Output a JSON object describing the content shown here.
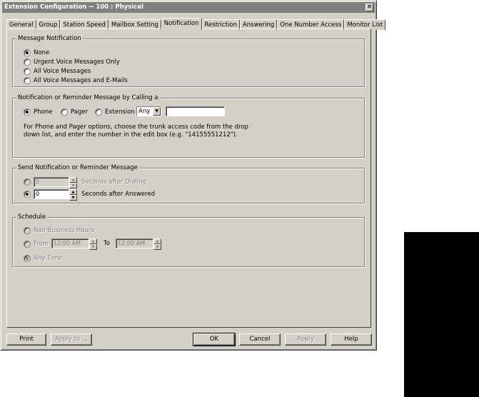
{
  "window": {
    "title": "Extension Configuration -- 100 : Physical",
    "close_glyph": "✕"
  },
  "tabs": [
    {
      "label": "General"
    },
    {
      "label": "Group"
    },
    {
      "label": "Station Speed"
    },
    {
      "label": "Mailbox Setting"
    },
    {
      "label": "Notification",
      "active": true
    },
    {
      "label": "Restriction"
    },
    {
      "label": "Answering"
    },
    {
      "label": "One Number Access"
    },
    {
      "label": "Monitor List"
    }
  ],
  "message_notification": {
    "title": "Message Notification",
    "options": [
      "None",
      "Urgent Voice Messages Only",
      "All Voice Messages",
      "All Voice Messages and E-Mails"
    ],
    "selected": "None"
  },
  "calling": {
    "title": "Notification or Reminder Message by Calling a",
    "options": [
      "Phone",
      "Pager",
      "Extension"
    ],
    "selected": "Phone",
    "access_code": "Any",
    "number_value": "",
    "help_line1": "For Phone and Pager options, choose the trunk access code from the drop",
    "help_line2": "down list, and enter the number in the edit box (e.g. \"14155551212\")."
  },
  "send": {
    "title": "Send Notification or Reminder Message",
    "dialing_value": "5",
    "dialing_label": "Seconds after Dialing",
    "answered_value": "0",
    "answered_label": "Seconds after Answered",
    "selected": "Seconds after Answered"
  },
  "schedule": {
    "title": "Schedule",
    "non_business": "Non Business Hours",
    "from_label": "From",
    "from_value": "12:00 AM",
    "to_label": "To",
    "to_value": "12:00 AM",
    "any_time": "Any Time",
    "selected": "Any Time"
  },
  "buttons": {
    "print": "Print",
    "apply_to": "Apply to ...",
    "ok": "OK",
    "cancel": "Cancel",
    "apply": "Apply",
    "help": "Help"
  },
  "icons": {
    "spin_up": "▲",
    "spin_down": "▼",
    "dropdown": "▼"
  }
}
